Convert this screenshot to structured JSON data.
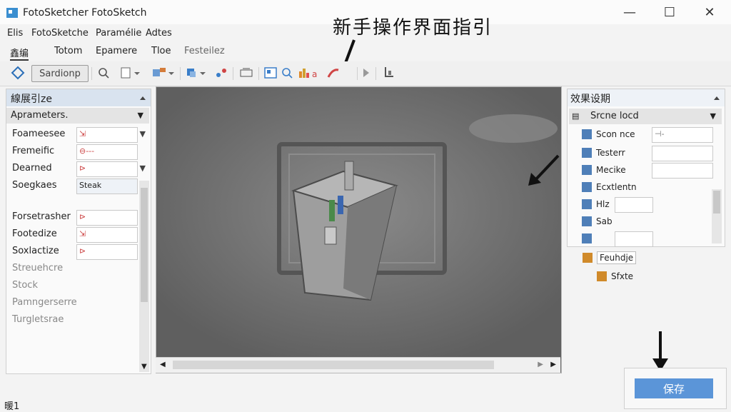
{
  "window": {
    "title": "FotoSketcher FotoSketch",
    "controls": {
      "minimize": "—",
      "maximize": "☐",
      "close": "✕"
    }
  },
  "menu": [
    "Elis",
    "FotoSketche",
    "Paramélie",
    "Adtes"
  ],
  "tabs": [
    "鑫编",
    "Totom",
    "Epamere",
    "Tloe",
    "Festeilez"
  ],
  "toolbar": {
    "sketch_button": "Sardionp"
  },
  "annotation_heading": "新手操作界面指引",
  "left_panel": {
    "title": "線展引ze",
    "subheader": "Aprameters.",
    "rows": [
      {
        "label": "Foameesee",
        "value": "⇲",
        "has_dropdown": true
      },
      {
        "label": "Freme⁠ific",
        "value": "⊖---",
        "has_dropdown": false
      },
      {
        "label": "Dearned",
        "value": "⊳",
        "has_dropdown": true
      },
      {
        "label": "Soegkaes",
        "value": "Steak",
        "has_dropdown": false
      },
      {
        "label": "Forsetrasher",
        "value": "⊳",
        "has_dropdown": false
      },
      {
        "label": "Footedize",
        "value": "⇲",
        "has_dropdown": true
      },
      {
        "label": "Soxlactize",
        "value": "⊳",
        "has_dropdown": false
      },
      {
        "label": "Streuehcre",
        "value": "",
        "has_dropdown": false
      },
      {
        "label": "Stock",
        "value": "",
        "has_dropdown": false
      },
      {
        "label": "Pamngerserre",
        "value": "",
        "has_dropdown": false
      },
      {
        "label": "Turgletsrae",
        "value": "",
        "has_dropdown": false
      }
    ]
  },
  "right_panel": {
    "title": "效果设期",
    "subheader": "Srcne locd",
    "items": [
      {
        "label": "Scon nce",
        "field": "⊣-"
      },
      {
        "label": "Testerr",
        "field": ""
      },
      {
        "label": "Mecike",
        "field": ""
      },
      {
        "label": "Ecxtlentn",
        "field": ""
      },
      {
        "label": "Hlz",
        "field": ""
      },
      {
        "label": "Sab",
        "field": ""
      },
      {
        "label": "",
        "field": ""
      },
      {
        "label": "Feuhdje",
        "field": ""
      },
      {
        "label": "Sfxte",
        "field": ""
      }
    ]
  },
  "save_button": "保存",
  "status_text": "暖1",
  "colors": {
    "accent": "#5b95d8",
    "canvas": "#6d6d6d"
  }
}
